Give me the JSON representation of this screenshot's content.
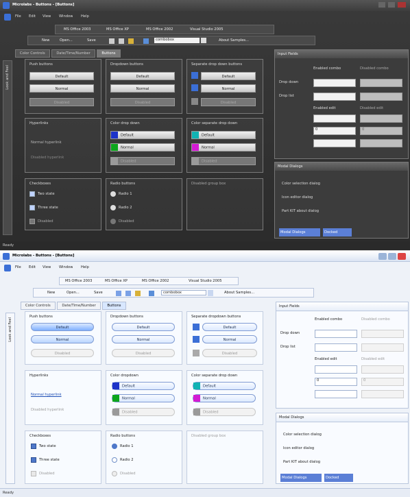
{
  "dark": {
    "title": "Microlabs - Buttons - [Buttons]",
    "menu": [
      "File",
      "Edit",
      "View",
      "Window",
      "Help"
    ],
    "toolbar_styles": [
      "MS Office 2003",
      "MS Office XP",
      "MS Office 2002",
      "Visual Studio 2005"
    ],
    "toolbar2": {
      "items": [
        "New",
        "Open...",
        "Save",
        "Cut",
        "Copy",
        "Paste",
        "Undo"
      ],
      "combo_value": "combobox",
      "about": "About Samples..."
    },
    "tabs": [
      "Color Controls",
      "Date/Time/Number",
      "Buttons"
    ],
    "active_tab_index": 2,
    "push_buttons": {
      "label": "Push buttons",
      "items": [
        "Default",
        "Normal",
        "Disabled"
      ]
    },
    "dropdown_buttons": {
      "label": "Dropdown buttons",
      "items": [
        "Default",
        "Normal",
        "Disabled"
      ]
    },
    "separate_dropdown_buttons": {
      "label": "Separate drop down buttons",
      "items": [
        "Default",
        "Normal",
        "Disabled"
      ]
    },
    "hyperlinks": {
      "label": "Hyperlinks",
      "normal": "Normal hyperlink",
      "disabled": "Disabled hyperlink"
    },
    "color_dropdown": {
      "label": "Color drop down",
      "items": [
        "Default",
        "Normal",
        "Disabled"
      ],
      "colors": [
        "#1d33c9",
        "#0da61d",
        "#9a9a9a"
      ]
    },
    "color_separate_dropdown": {
      "label": "Color separate drop down",
      "items": [
        "Default",
        "Normal",
        "Disabled"
      ],
      "colors": [
        "#11b3b3",
        "#d31bd3",
        "#9a9a9a"
      ]
    },
    "checkboxes": {
      "label": "Checkboxes",
      "items": [
        "Two state",
        "Three state",
        "Disabled"
      ]
    },
    "radio_buttons": {
      "label": "Radio buttons",
      "items": [
        "Radio 1",
        "Radio 2",
        "Disabled"
      ]
    },
    "disabled_group": {
      "label": "Disabled group box"
    },
    "input_fields": {
      "title": "Input Fields",
      "enabled_combo": "Enabled combo",
      "disabled_combo": "Disabled combo",
      "dropdown": "Drop down",
      "droplist": "Drop list",
      "enabled_edit": "Enabled edit",
      "disabled_edit": "Disabled edit",
      "spin_enabled": "0",
      "spin_disabled": "0"
    },
    "modal_dialogs": {
      "title": "Modal Dialogs",
      "items": [
        "Color selection dialog",
        "Icon editor dialog",
        "Part KIT about dialog"
      ]
    },
    "bottom_tabs": [
      "Modal Dialogs",
      "Docked"
    ],
    "status": "Ready",
    "sidebar_text": "Look and Feel"
  },
  "light": {
    "title": "Microlabs - Buttons - [Buttons]",
    "menu": [
      "File",
      "Edit",
      "View",
      "Window",
      "Help"
    ],
    "toolbar_styles": [
      "MS Office 2003",
      "MS Office XP",
      "MS Office 2002",
      "Visual Studio 2005"
    ],
    "toolbar2": {
      "items": [
        "New",
        "Open...",
        "Save",
        "Cut",
        "Copy",
        "Paste",
        "Undo"
      ],
      "combo_value": "combobox",
      "about": "About Samples..."
    },
    "tabs": [
      "Color Controls",
      "Date/Time/Number",
      "Buttons"
    ],
    "active_tab_index": 2,
    "push_buttons": {
      "label": "Push buttons",
      "items": [
        "Default",
        "Normal",
        "Disabled"
      ]
    },
    "dropdown_buttons": {
      "label": "Dropdown buttons",
      "items": [
        "Default",
        "Normal",
        "Disabled"
      ]
    },
    "separate_dropdown_buttons": {
      "label": "Separate dropdown buttons",
      "items": [
        "Default",
        "Normal",
        "Disabled"
      ]
    },
    "hyperlinks": {
      "label": "Hyperlinks",
      "normal": "Normal hyperlink",
      "disabled": "Disabled hyperlink"
    },
    "color_dropdown": {
      "label": "Color dropdown",
      "items": [
        "Default",
        "Normal",
        "Disabled"
      ],
      "colors": [
        "#1d33c9",
        "#0da61d",
        "#9a9a9a"
      ]
    },
    "color_separate_dropdown": {
      "label": "Color separate drop down",
      "items": [
        "Default",
        "Normal",
        "Disabled"
      ],
      "colors": [
        "#11b3b3",
        "#d31bd3",
        "#9a9a9a"
      ]
    },
    "checkboxes": {
      "label": "Checkboxes",
      "items": [
        "Two state",
        "Three state",
        "Disabled"
      ]
    },
    "radio_buttons": {
      "label": "Radio buttons",
      "items": [
        "Radio 1",
        "Radio 2",
        "Disabled"
      ]
    },
    "disabled_group": {
      "label": "Disabled group box"
    },
    "input_fields": {
      "title": "Input Fields",
      "enabled_combo": "Enabled combo",
      "disabled_combo": "Disabled combo",
      "dropdown": "Drop down",
      "droplist": "Drop list",
      "enabled_edit": "Enabled edit",
      "disabled_edit": "Disabled edit",
      "spin_enabled": "0",
      "spin_disabled": "0"
    },
    "modal_dialogs": {
      "title": "Modal Dialogs",
      "items": [
        "Color selection dialog",
        "Icon editor dialog",
        "Part KIT about dialog"
      ]
    },
    "bottom_tabs": [
      "Modal Dialogs",
      "Docked"
    ],
    "status": "Ready",
    "sidebar_text": "Look and Feel"
  }
}
